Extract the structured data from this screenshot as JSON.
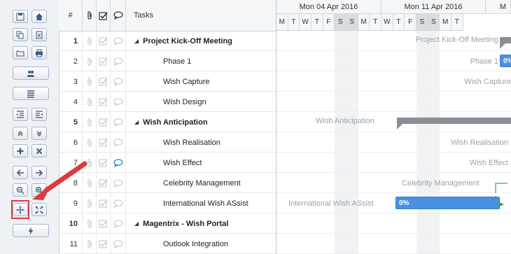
{
  "grid": {
    "headers": {
      "num": "#",
      "tasks": "Tasks"
    },
    "rows": [
      {
        "num": "1",
        "task": "Project Kick-Off Meeting",
        "parent": true,
        "comment": false
      },
      {
        "num": "2",
        "task": "Phase 1",
        "parent": false,
        "comment": false
      },
      {
        "num": "3",
        "task": "Wish Capture",
        "parent": false,
        "comment": false
      },
      {
        "num": "4",
        "task": "Wish Design",
        "parent": false,
        "comment": false
      },
      {
        "num": "5",
        "task": "Wish Anticipation",
        "parent": true,
        "comment": false
      },
      {
        "num": "6",
        "task": "Wish Realisation",
        "parent": false,
        "comment": false
      },
      {
        "num": "7",
        "task": "Wish Effect",
        "parent": false,
        "comment": true
      },
      {
        "num": "8",
        "task": "Celebrity Management",
        "parent": false,
        "comment": false
      },
      {
        "num": "9",
        "task": "International Wish ASsist",
        "parent": false,
        "comment": false
      },
      {
        "num": "10",
        "task": "Magentrix - Wish Portal",
        "parent": true,
        "comment": false
      },
      {
        "num": "11",
        "task": "Outlook Integration",
        "parent": false,
        "comment": false
      }
    ]
  },
  "gantt": {
    "weeks": [
      "Mon 04 Apr 2016",
      "Mon 11 Apr 2016",
      "M"
    ],
    "days": [
      "M",
      "T",
      "W",
      "T",
      "F",
      "S",
      "S",
      "M",
      "T",
      "W",
      "T",
      "F",
      "S",
      "S",
      "M",
      "T"
    ],
    "labels": {
      "r1": "Project Kick-Off Meeting",
      "r2": "Phase 1",
      "r3": "Wish Capture",
      "r5": "Wish Anticipation",
      "r6": "Wish Realisation",
      "r7": "Wish Effect",
      "r8": "Celebrity Management",
      "r9": "International Wish ASsist"
    },
    "progress": {
      "r2": "0%",
      "r9": "0%"
    }
  },
  "colors": {
    "bar": "#4a90e2",
    "summary": "#8a8f96",
    "highlight": "#e0393e"
  }
}
